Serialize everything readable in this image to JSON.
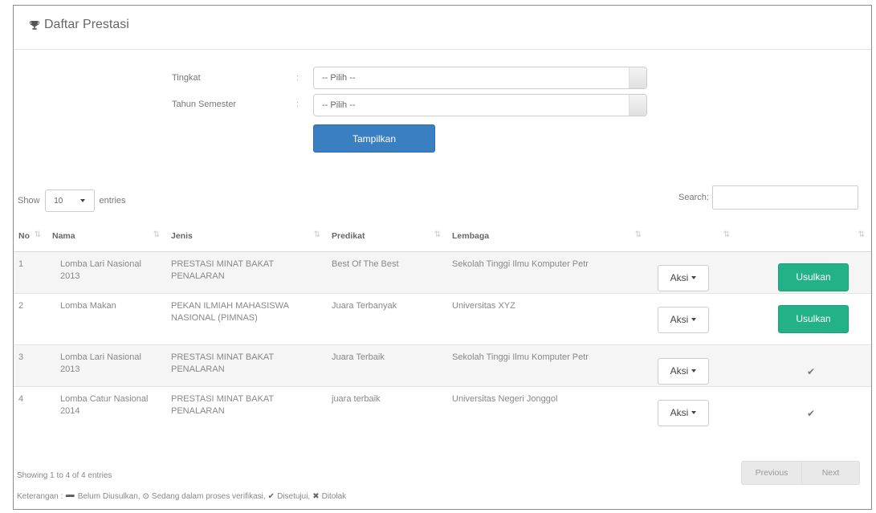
{
  "panel": {
    "title": "Daftar Prestasi",
    "icon": "trophy-icon"
  },
  "filters": {
    "tingkat": {
      "label": "Tingkat",
      "colon": ":",
      "value": "-- Pilih --"
    },
    "tahun": {
      "label": "Tahun Semester",
      "colon": ":",
      "value": "-- Pilih --"
    },
    "submit_label": "Tampilkan"
  },
  "datatable": {
    "show_label": "Show",
    "length_value": "10",
    "entries_label": "entries",
    "search_label": "Search:",
    "search_value": "",
    "columns": [
      "No",
      "Nama",
      "Jenis",
      "Predikat",
      "Lembaga",
      "",
      ""
    ],
    "rows": [
      {
        "no": "1",
        "nama": "Lomba Lari Nasional 2013",
        "jenis": "PRESTASI MINAT BAKAT PENALARAN",
        "predikat": "Best Of The Best",
        "lembaga": "Sekolah Tinggi Ilmu Komputer Petr",
        "aksi": "Aksi",
        "status": "Usulkan"
      },
      {
        "no": "2",
        "nama": "Lomba Makan",
        "jenis": "PEKAN ILMIAH MAHASISWA NASIONAL (PIMNAS)",
        "predikat": "Juara Terbanyak",
        "lembaga": "Universitas XYZ",
        "aksi": "Aksi",
        "status": "Usulkan"
      },
      {
        "no": "3",
        "nama": "Lomba Lari Nasional 2013",
        "jenis": "PRESTASI MINAT BAKAT PENALARAN",
        "predikat": "Juara Terbaik",
        "lembaga": "Sekolah Tinggi Ilmu Komputer Petr",
        "aksi": "Aksi",
        "status": "✔"
      },
      {
        "no": "4",
        "nama": "Lomba Catur Nasional 2014",
        "jenis": "PRESTASI MINAT BAKAT PENALARAN",
        "predikat": "juara terbaik",
        "lembaga": "Universitas Negeri Jonggol",
        "aksi": "Aksi",
        "status": "✔"
      }
    ],
    "info": "Showing 1 to 4 of 4 entries",
    "previous_label": "Previous",
    "next_label": "Next"
  },
  "legend": {
    "prefix": "Keterangan :",
    "belum_symbol": "➖",
    "belum": "Belum Diusulkan,",
    "sedang_symbol": "⊙",
    "sedang": "Sedang dalam proses verifikasi,",
    "disetujui_symbol": "✔",
    "disetujui": "Disetujui,",
    "ditolak_symbol": "✖",
    "ditolak": "Ditolak"
  },
  "colors": {
    "primary": "#3a7fc1",
    "success": "#23b287",
    "border": "#8c8c8c"
  }
}
